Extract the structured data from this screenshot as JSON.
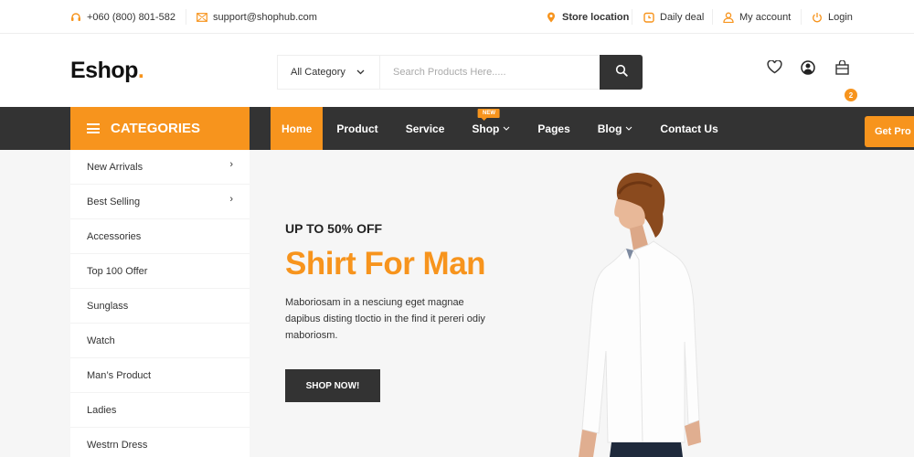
{
  "topbar": {
    "phone": "+060 (800) 801-582",
    "email": "support@shophub.com",
    "links": [
      {
        "label": "Store location",
        "icon": "location-pin-icon"
      },
      {
        "label": "Daily deal",
        "icon": "clock-icon"
      },
      {
        "label": "My account",
        "icon": "user-icon"
      },
      {
        "label": "Login",
        "icon": "power-icon"
      }
    ]
  },
  "header": {
    "logo": "Eshop",
    "logo_dot": ".",
    "category_select": "All Category",
    "search_placeholder": "Search Products Here.....",
    "cart_count": "2"
  },
  "nav": {
    "categories_label": "CATEGORIES",
    "items": [
      {
        "label": "Home",
        "active": true
      },
      {
        "label": "Product"
      },
      {
        "label": "Service"
      },
      {
        "label": "Shop",
        "dropdown": true,
        "tag": "NEW"
      },
      {
        "label": "Pages"
      },
      {
        "label": "Blog",
        "dropdown": true
      },
      {
        "label": "Contact Us"
      }
    ],
    "get_pro": "Get Pro"
  },
  "sidebar": {
    "items": [
      {
        "label": "New Arrivals",
        "has_sub": true
      },
      {
        "label": "Best Selling",
        "has_sub": true
      },
      {
        "label": "Accessories"
      },
      {
        "label": "Top 100 Offer"
      },
      {
        "label": "Sunglass"
      },
      {
        "label": "Watch"
      },
      {
        "label": "Man’s Product"
      },
      {
        "label": "Ladies"
      },
      {
        "label": "Westrn Dress"
      }
    ]
  },
  "hero": {
    "subtitle": "UP TO 50% OFF",
    "title": "Shirt For Man",
    "description": "Maboriosam in a nesciung eget magnae dapibus disting tloctio in the find it pereri odiy maboriosm.",
    "cta": "SHOP NOW!"
  },
  "colors": {
    "accent": "#f7941d",
    "dark": "#333333"
  }
}
